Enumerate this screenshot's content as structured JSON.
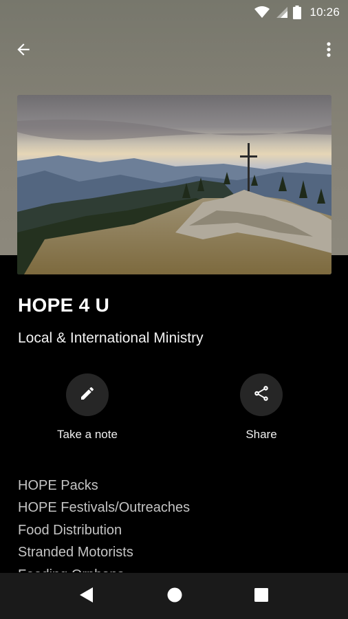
{
  "status_bar": {
    "time": "10:26"
  },
  "toolbar": {
    "back_icon": "arrow-back-icon",
    "menu_icon": "more-vert-icon"
  },
  "hero": {
    "image": "mountain-summit-cross-photo"
  },
  "page": {
    "title": "HOPE 4 U",
    "subtitle": "Local & International Ministry"
  },
  "actions": [
    {
      "label": "Take a note",
      "icon": "pencil-icon"
    },
    {
      "label": "Share",
      "icon": "share-icon"
    }
  ],
  "items": [
    "HOPE Packs",
    "HOPE Festivals/Outreaches",
    "Food Distribution",
    "Stranded Motorists",
    "Feeding Orphans"
  ],
  "colors": {
    "background": "#000000",
    "header": "#88847a",
    "action_circle": "#262626",
    "item_text": "#c4c4c4"
  }
}
